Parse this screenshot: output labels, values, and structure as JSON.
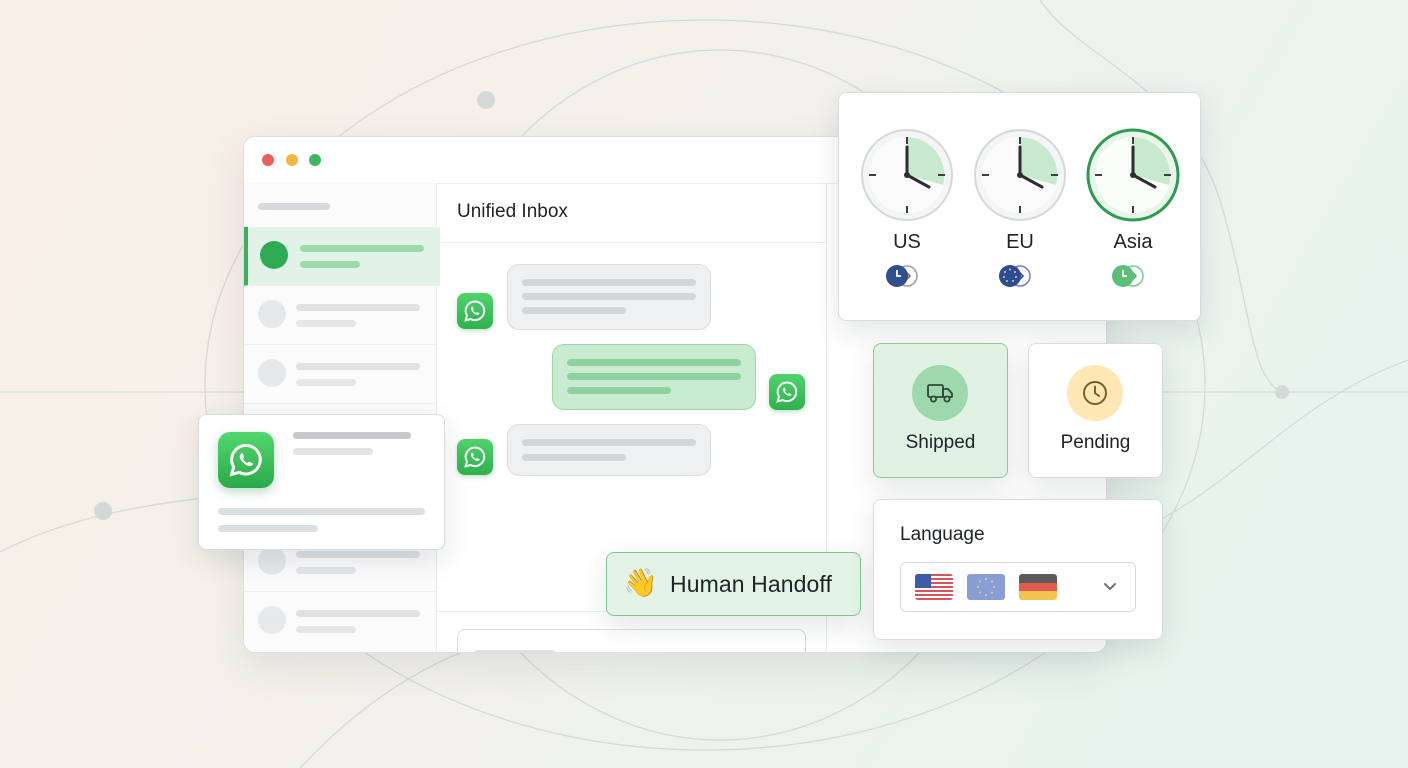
{
  "inbox": {
    "title": "Unified Inbox"
  },
  "handoff": {
    "emoji": "👋",
    "label": "Human Handoff"
  },
  "regions": [
    {
      "name": "US",
      "accent": "#2f4f8f"
    },
    {
      "name": "EU",
      "accent": "#2c4c9a"
    },
    {
      "name": "Asia",
      "accent": "#3fae5f"
    }
  ],
  "status": {
    "shipped": {
      "label": "Shipped",
      "icon": "truck-icon"
    },
    "pending": {
      "label": "Pending",
      "icon": "clock-icon"
    }
  },
  "language": {
    "title": "Language",
    "flags": [
      "us-flag",
      "eu-flag",
      "germany-flag"
    ]
  },
  "colors": {
    "brand_green": "#2fb14f",
    "accent_green_light": "#e3f4e6",
    "pending_yellow": "#fde7b4"
  }
}
